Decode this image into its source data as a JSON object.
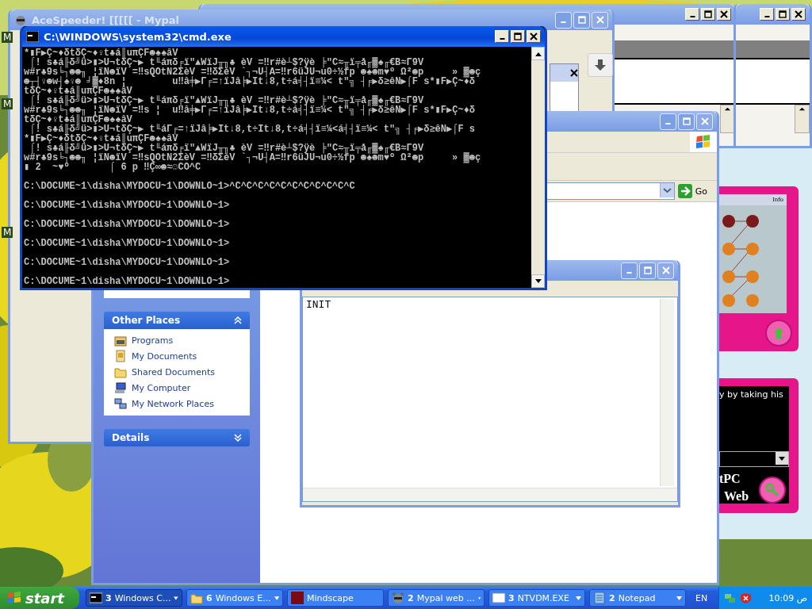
{
  "desktop_labels": [
    "M",
    "M",
    "M"
  ],
  "mypal_window": {
    "title": "AceSpeeder! [[[[[ - Mypal"
  },
  "explorer_window": {
    "go": "Go",
    "other_places": {
      "title": "Other Places",
      "expanded": true,
      "items": [
        {
          "label": "Programs",
          "kind": "programs"
        },
        {
          "label": "My Documents",
          "kind": "documents"
        },
        {
          "label": "Shared Documents",
          "kind": "folder"
        },
        {
          "label": "My Computer",
          "kind": "computer"
        },
        {
          "label": "My Network Places",
          "kind": "network"
        }
      ]
    },
    "details": {
      "title": "Details",
      "expanded": false
    }
  },
  "notepad_window": {
    "text": "INIT"
  },
  "side_app": {
    "info": "Info",
    "caption": "y by taking his",
    "brand": [
      "tPC",
      "Web"
    ]
  },
  "cmd_window": {
    "title": "C:\\WINDOWS\\system32\\cmd.exe",
    "lines": [
      {
        "kind": "output",
        "text": "*▮F▶Ç~♦δtδÇ~♦♀t♣á║uπÇF☻♠♠âV"
      },
      {
        "kind": "output",
        "text": " ⌠! s♣á╟δ╝ü>▮>U¬tδÇ~▶ t╙áπδ╒ï\"▲WïJ╥╖♣ èV =‼r#è┴$?ÿè ╞\"C≈╥ï╤å╓▓♠╓€B≈Γ9V"
      },
      {
        "kind": "output",
        "text": "w#r♣9s╘┐☻☻╖ ¦ïN☻ïV =‼sQOtN2ΣèV =‼δΣèV `┐¬U┤A=‼r6üJU¬u0÷½fp ☻♠☻m♥º Ω²☻p     » ▓☻ç"
      },
      {
        "kind": "output",
        "text": "☻┬┤♀☻w┤♠♀☻ ╛▓♦8n ¦        u‼â╪▶Γ╒=↑ïJâ╞▶It↓8,t÷á╡┤ï≡¼< t\"╗ ┤╒▶δ≥êN▶⌠F s*▮F▶Ç~♦δ"
      },
      {
        "kind": "output",
        "text": "tδÇ~♦♀t♣á║uπÇF☻♠♠âV"
      },
      {
        "kind": "output",
        "text": " ⌠! s♣á╟δ╝ü>▮>U¬tδÇ~▶ t╙áπδ╒ï\"▲WïJ╥╖♣ èV =‼r#è┴$?ÿè ╞\"C≈╥ï╤å╓▓♠╓€B≈Γ9V"
      },
      {
        "kind": "output",
        "text": "w#r♣9s╘┐☻☻╖ ¦ïN☻ïV =‼s ¦  u‼â╪▶Γ╒=↑ïJâ╞▶It↓8,t÷á╡┤ï≡¼< t\"╗ ┤╒▶δ≥êN▶⌠F s*▮F▶Ç~♦δ"
      },
      {
        "kind": "output",
        "text": "tδÇ~♦♀t♣á║uπÇF☻♠♠âV"
      },
      {
        "kind": "output",
        "text": " ⌠! s♣á╟δ╝ü>▮>U¬tδÇ~▶ t╙áΓ╒=↑ïJâ╞▶It↓8,t÷It↓8,t÷á╡┤ï≡¼<á╡┤ï≡¼< t\"╗ ┤╒▶δ≥êN▶⌠F s"
      },
      {
        "kind": "output",
        "text": "*▮F▶Ç~♦δtδÇ~♦♀t♣á║uπÇF☻♠♠âV"
      },
      {
        "kind": "output",
        "text": " ⌠! s♣á╟δ╝ü>▮>U¬tδÇ~▶ t╙áπδ╒ï\"▲WïJ╥╖♣ èV =‼r#è┴$?ÿè ╞\"C≈╥ï╤å╓▓♠╓€B≈Γ9V"
      },
      {
        "kind": "output",
        "text": "w#r♣9s╘┐☻☻╖ ¦ïN☻ïV =‼sQOtN2ΣèV =‼δΣèV `┐¬U┤A=‼r6üJU¬u0÷½fp ☻♠☻m♥º Ω²☻p     » ▓☻ç"
      },
      {
        "kind": "output",
        "text": "▮ 2  ~♥º       ⌠ 6 p ‼Ç∞☻≈☺CO^C"
      },
      {
        "kind": "prompt",
        "text": "C:\\DOCUME~1\\disha\\MYDOCU~1\\DOWNLO~1>^C^C^C^C^C^C^C^C^C^C^C"
      },
      {
        "kind": "prompt",
        "text": "C:\\DOCUME~1\\disha\\MYDOCU~1\\DOWNLO~1>"
      },
      {
        "kind": "prompt",
        "text": "C:\\DOCUME~1\\disha\\MYDOCU~1\\DOWNLO~1>"
      },
      {
        "kind": "prompt",
        "text": "C:\\DOCUME~1\\disha\\MYDOCU~1\\DOWNLO~1>"
      },
      {
        "kind": "prompt",
        "text": "C:\\DOCUME~1\\disha\\MYDOCU~1\\DOWNLO~1>"
      },
      {
        "kind": "prompt",
        "text": "C:\\DOCUME~1\\disha\\MYDOCU~1\\DOWNLO~1>"
      }
    ]
  },
  "taskbar": {
    "start": "start",
    "buttons": [
      {
        "count": "3",
        "label": "Windows C...",
        "kind": "cmd",
        "selected": true
      },
      {
        "count": "6",
        "label": "Windows E...",
        "kind": "folder",
        "selected": false
      },
      {
        "label": "Mindscape",
        "kind": "square",
        "selected": false
      },
      {
        "count": "2",
        "label": "Mypal web ...",
        "kind": "raccoon",
        "selected": false
      },
      {
        "count": "3",
        "label": "NTVDM.EXE",
        "kind": "window",
        "selected": false
      },
      {
        "count": "2",
        "label": "Notepad",
        "kind": "notepad",
        "selected": false
      }
    ],
    "language": "EN",
    "clock": "10:09 ص"
  }
}
